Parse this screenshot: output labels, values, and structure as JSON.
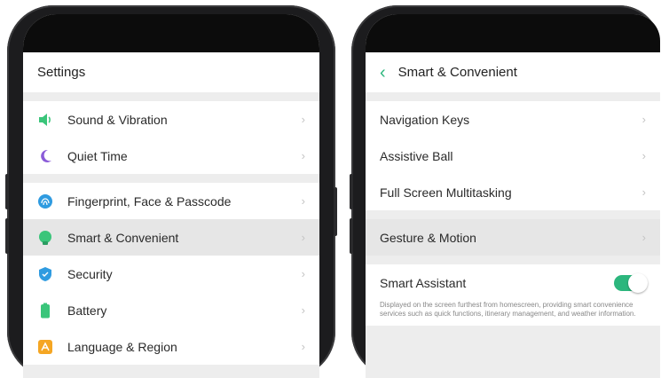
{
  "left": {
    "title": "Settings",
    "group1": [
      {
        "label": "Sound & Vibration",
        "icon": "speaker-icon",
        "color": "#3ac57a"
      },
      {
        "label": "Quiet Time",
        "icon": "moon-icon",
        "color": "#8a5bd8"
      }
    ],
    "group2": [
      {
        "label": "Fingerprint, Face & Passcode",
        "icon": "fingerprint-icon",
        "color": "#2f9be0"
      },
      {
        "label": "Smart & Convenient",
        "icon": "smart-icon",
        "color": "#3ac57a",
        "highlighted": true
      },
      {
        "label": "Security",
        "icon": "shield-icon",
        "color": "#2f9be0"
      },
      {
        "label": "Battery",
        "icon": "battery-icon",
        "color": "#3ac57a"
      },
      {
        "label": "Language & Region",
        "icon": "globe-icon",
        "color": "#f5a623"
      }
    ]
  },
  "right": {
    "title": "Smart & Convenient",
    "group1": [
      {
        "label": "Navigation Keys"
      },
      {
        "label": "Assistive Ball"
      },
      {
        "label": "Full Screen Multitasking"
      }
    ],
    "group2": [
      {
        "label": "Gesture & Motion",
        "highlighted": true
      }
    ],
    "smart_assistant": {
      "label": "Smart Assistant",
      "enabled": true,
      "description": "Displayed on the screen furthest from homescreen, providing smart convenience services such as quick functions, itinerary management, and weather information."
    }
  },
  "accent_color": "#2cb67d"
}
